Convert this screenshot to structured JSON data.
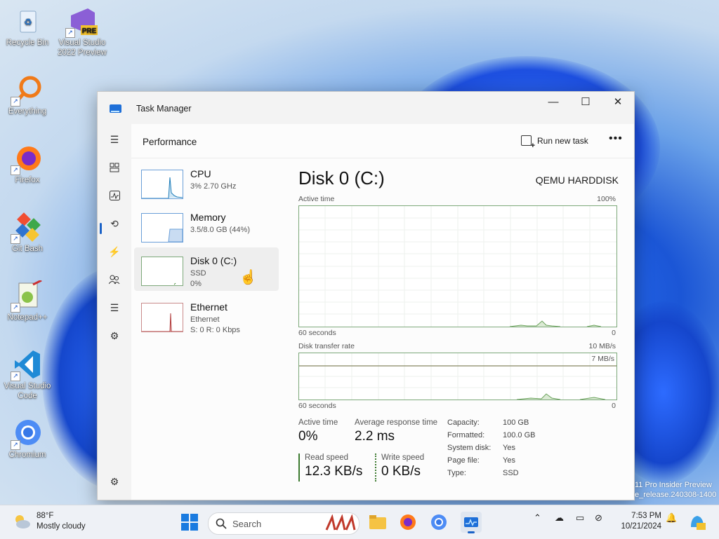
{
  "desktop": {
    "icons": [
      {
        "label": "Recycle Bin"
      },
      {
        "label": "Visual Studio 2022 Preview",
        "badge": "PRE"
      },
      {
        "label": "Everything"
      },
      {
        "label": "Firefox"
      },
      {
        "label": "Git Bash"
      },
      {
        "label": "Notepad++"
      },
      {
        "label": "Visual Studio Code"
      },
      {
        "label": "Chromium"
      }
    ],
    "watermark_line1": "11 Pro Insider Preview",
    "watermark_line2": "e_release.240308-1400"
  },
  "window": {
    "title": "Task Manager",
    "minimize": "—",
    "maximize": "☐",
    "close": "✕"
  },
  "header": {
    "page_title": "Performance",
    "run_new_task": "Run new task",
    "more": "•••"
  },
  "resources": [
    {
      "name": "CPU",
      "sub1": "3% 2.70 GHz",
      "sub2": ""
    },
    {
      "name": "Memory",
      "sub1": "3.5/8.0 GB (44%)",
      "sub2": ""
    },
    {
      "name": "Disk 0 (C:)",
      "sub1": "SSD",
      "sub2": "0%"
    },
    {
      "name": "Ethernet",
      "sub1": "Ethernet",
      "sub2": "S: 0 R: 0 Kbps"
    }
  ],
  "detail": {
    "title": "Disk 0 (C:)",
    "model": "QEMU HARDDISK",
    "graph1": {
      "label": "Active time",
      "max": "100%",
      "xlabel": "60 seconds",
      "min": "0"
    },
    "graph2": {
      "label": "Disk transfer rate",
      "max": "10 MB/s",
      "inner_max": "7 MB/s",
      "xlabel": "60 seconds",
      "min": "0"
    },
    "active_time": {
      "label": "Active time",
      "value": "0%"
    },
    "avg_response": {
      "label": "Average response time",
      "value": "2.2 ms"
    },
    "read_speed": {
      "label": "Read speed",
      "value": "12.3 KB/s"
    },
    "write_speed": {
      "label": "Write speed",
      "value": "0 KB/s"
    },
    "props": [
      {
        "k": "Capacity:",
        "v": "100 GB"
      },
      {
        "k": "Formatted:",
        "v": "100.0 GB"
      },
      {
        "k": "System disk:",
        "v": "Yes"
      },
      {
        "k": "Page file:",
        "v": "Yes"
      },
      {
        "k": "Type:",
        "v": "SSD"
      }
    ]
  },
  "taskbar": {
    "temp": "88°F",
    "condition": "Mostly cloudy",
    "search_placeholder": "Search",
    "time": "7:53 PM",
    "date": "10/21/2024"
  }
}
